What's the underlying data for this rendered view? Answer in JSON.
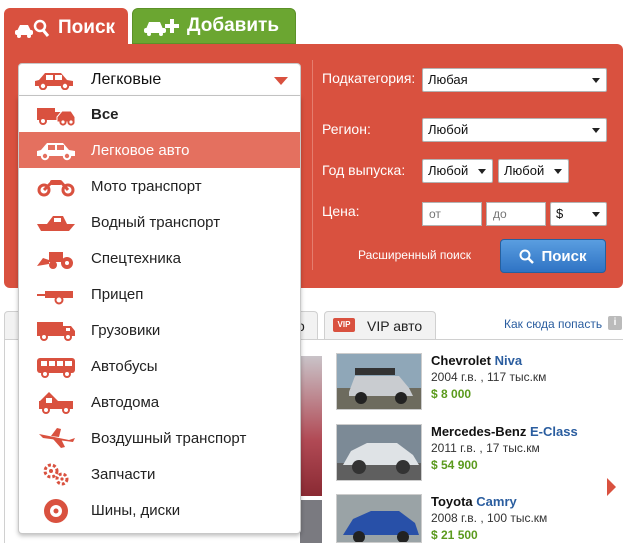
{
  "tabs": {
    "search": "Поиск",
    "add": "Добавить"
  },
  "form": {
    "subcategory_label": "Подкатегория:",
    "subcategory_value": "Любая",
    "region_label": "Регион:",
    "region_value": "Любой",
    "year_label": "Год выпуска:",
    "year_from": "Любой",
    "year_to": "Любой",
    "price_label": "Цена:",
    "price_from_placeholder": "от",
    "price_to_placeholder": "до",
    "currency": "$",
    "advanced_link": "Расширенный поиск",
    "search_button": "Поиск"
  },
  "dropdown": {
    "selected": "Легковые",
    "items": [
      {
        "label": "Все",
        "icon": "truck-car-icon"
      },
      {
        "label": "Легковое авто",
        "icon": "car-icon"
      },
      {
        "label": "Мото транспорт",
        "icon": "motorcycle-icon"
      },
      {
        "label": "Водный транспорт",
        "icon": "boat-icon"
      },
      {
        "label": "Спецтехника",
        "icon": "tractor-icon"
      },
      {
        "label": "Прицеп",
        "icon": "trailer-icon"
      },
      {
        "label": "Грузовики",
        "icon": "truck-icon"
      },
      {
        "label": "Автобусы",
        "icon": "bus-icon"
      },
      {
        "label": "Автодома",
        "icon": "motorhome-icon"
      },
      {
        "label": "Воздушный транспорт",
        "icon": "airplane-icon"
      },
      {
        "label": "Запчасти",
        "icon": "gears-icon"
      },
      {
        "label": "Шины, диски",
        "icon": "tire-icon"
      }
    ]
  },
  "lower": {
    "vip_badge": "VIP",
    "vip_tab": "VIP авто",
    "partial_tab": "о",
    "how_link": "Как сюда попасть",
    "info": "i"
  },
  "ads": [
    {
      "make": "Chevrolet",
      "model": "Niva",
      "meta": "2004 г.в. , 117 тыс.км",
      "price": "$ 8 000"
    },
    {
      "make": "Mercedes-Benz",
      "model": "E-Class",
      "meta": "2011 г.в. , 17 тыс.км",
      "price": "$ 54 900"
    },
    {
      "make": "Toyota",
      "model": "Camry",
      "meta": "2008 г.в. , 100 тыс.км",
      "price": "$ 21 500"
    }
  ],
  "colors": {
    "primary_red": "#d9513f",
    "green": "#6ba631",
    "blue": "#2f73c4",
    "price_green": "#5b9a1d"
  }
}
